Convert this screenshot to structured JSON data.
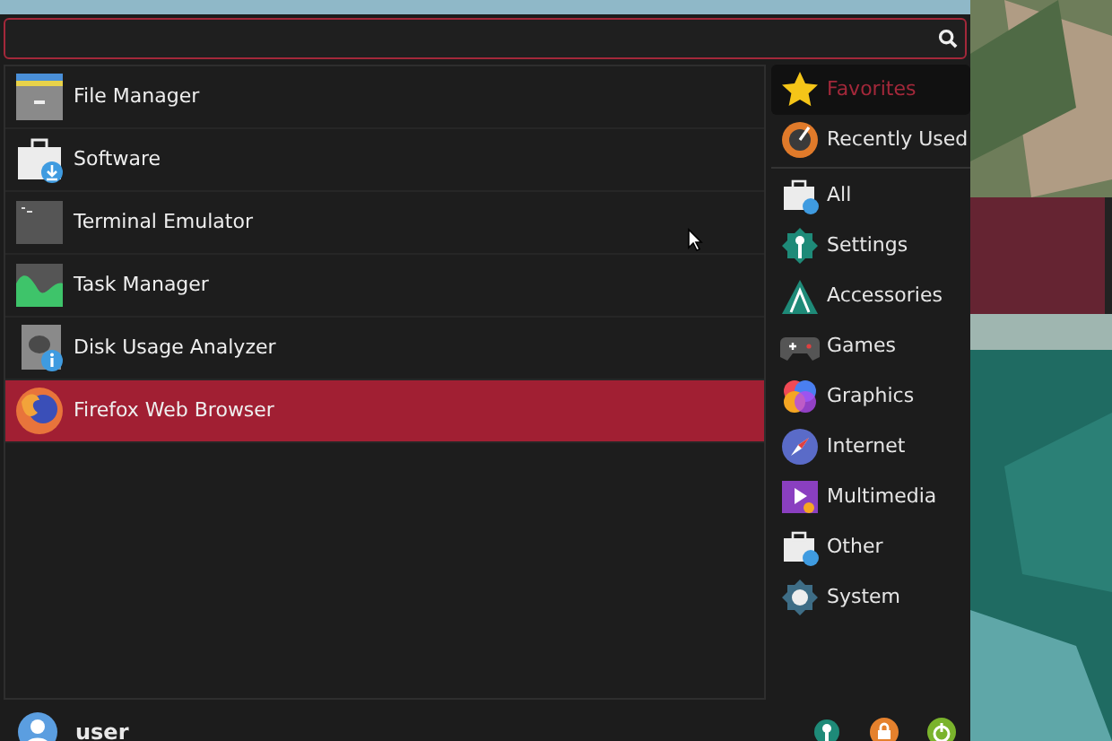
{
  "apps": [
    {
      "name": "File Manager",
      "selected": false
    },
    {
      "name": "Software",
      "selected": false
    },
    {
      "name": "Terminal Emulator",
      "selected": false
    },
    {
      "name": "Task Manager",
      "selected": false
    },
    {
      "name": "Disk Usage Analyzer",
      "selected": false
    },
    {
      "name": "Firefox Web Browser",
      "selected": true
    }
  ],
  "categories": [
    {
      "name": "Favorites",
      "selected": true
    },
    {
      "name": "Recently Used",
      "selected": false
    },
    {
      "name": "All",
      "selected": false
    },
    {
      "name": "Settings",
      "selected": false
    },
    {
      "name": "Accessories",
      "selected": false
    },
    {
      "name": "Games",
      "selected": false
    },
    {
      "name": "Graphics",
      "selected": false
    },
    {
      "name": "Internet",
      "selected": false
    },
    {
      "name": "Multimedia",
      "selected": false
    },
    {
      "name": "Other",
      "selected": false
    },
    {
      "name": "System",
      "selected": false
    }
  ],
  "user": {
    "name": "user"
  }
}
